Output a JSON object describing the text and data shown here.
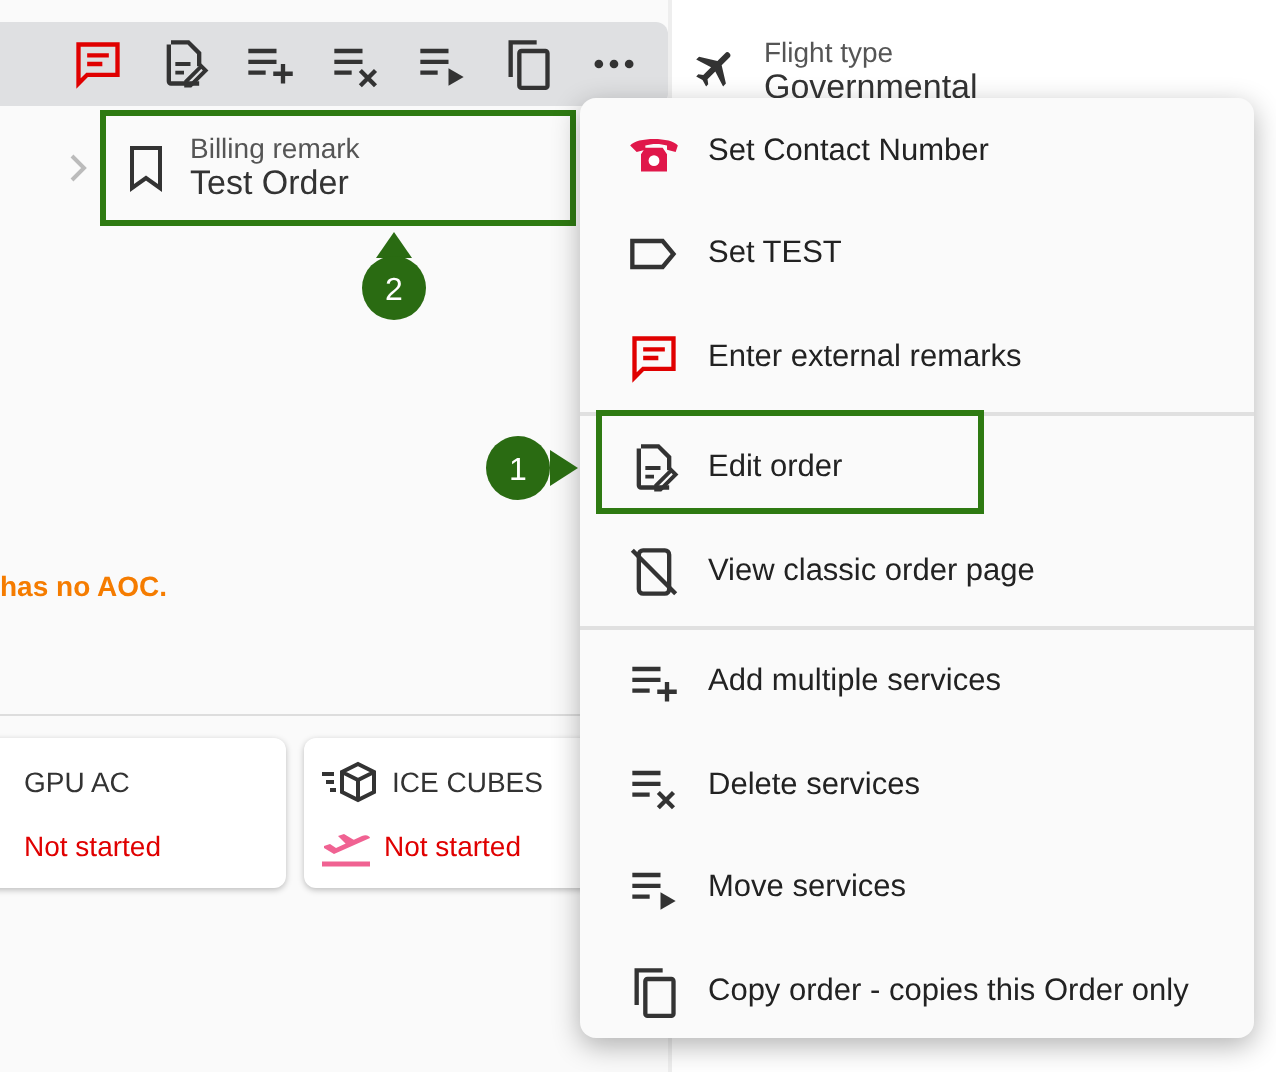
{
  "toolbar": {
    "buttons": [
      {
        "kind": "remark"
      },
      {
        "kind": "edit"
      },
      {
        "kind": "add-list"
      },
      {
        "kind": "delete-list"
      },
      {
        "kind": "move-list"
      },
      {
        "kind": "copy"
      },
      {
        "kind": "more"
      }
    ]
  },
  "billing": {
    "label": "Billing remark",
    "value": "Test Order",
    "callout": "2"
  },
  "warning": "has no AOC.",
  "services": [
    {
      "name": "GPU AC",
      "status": "Not started",
      "kind": "plain"
    },
    {
      "name": "ICE CUBES",
      "status": "Not started",
      "kind": "cargo"
    }
  ],
  "flight_type": {
    "label": "Flight type",
    "value": "Governmental"
  },
  "menu": {
    "groups": [
      [
        {
          "label": "Set Contact Number",
          "kind": "phone"
        },
        {
          "label": "Set TEST",
          "kind": "tag"
        },
        {
          "label": "Enter external remarks",
          "kind": "remark"
        }
      ],
      [
        {
          "label": "Edit order",
          "kind": "edit",
          "callout": "1"
        },
        {
          "label": "View classic order page",
          "kind": "no-phone"
        }
      ],
      [
        {
          "label": "Add multiple services",
          "kind": "add-list"
        },
        {
          "label": "Delete services",
          "kind": "delete-list"
        },
        {
          "label": "Move services",
          "kind": "move-list"
        },
        {
          "label": "Copy order - copies this Order only",
          "kind": "copy"
        }
      ]
    ]
  }
}
